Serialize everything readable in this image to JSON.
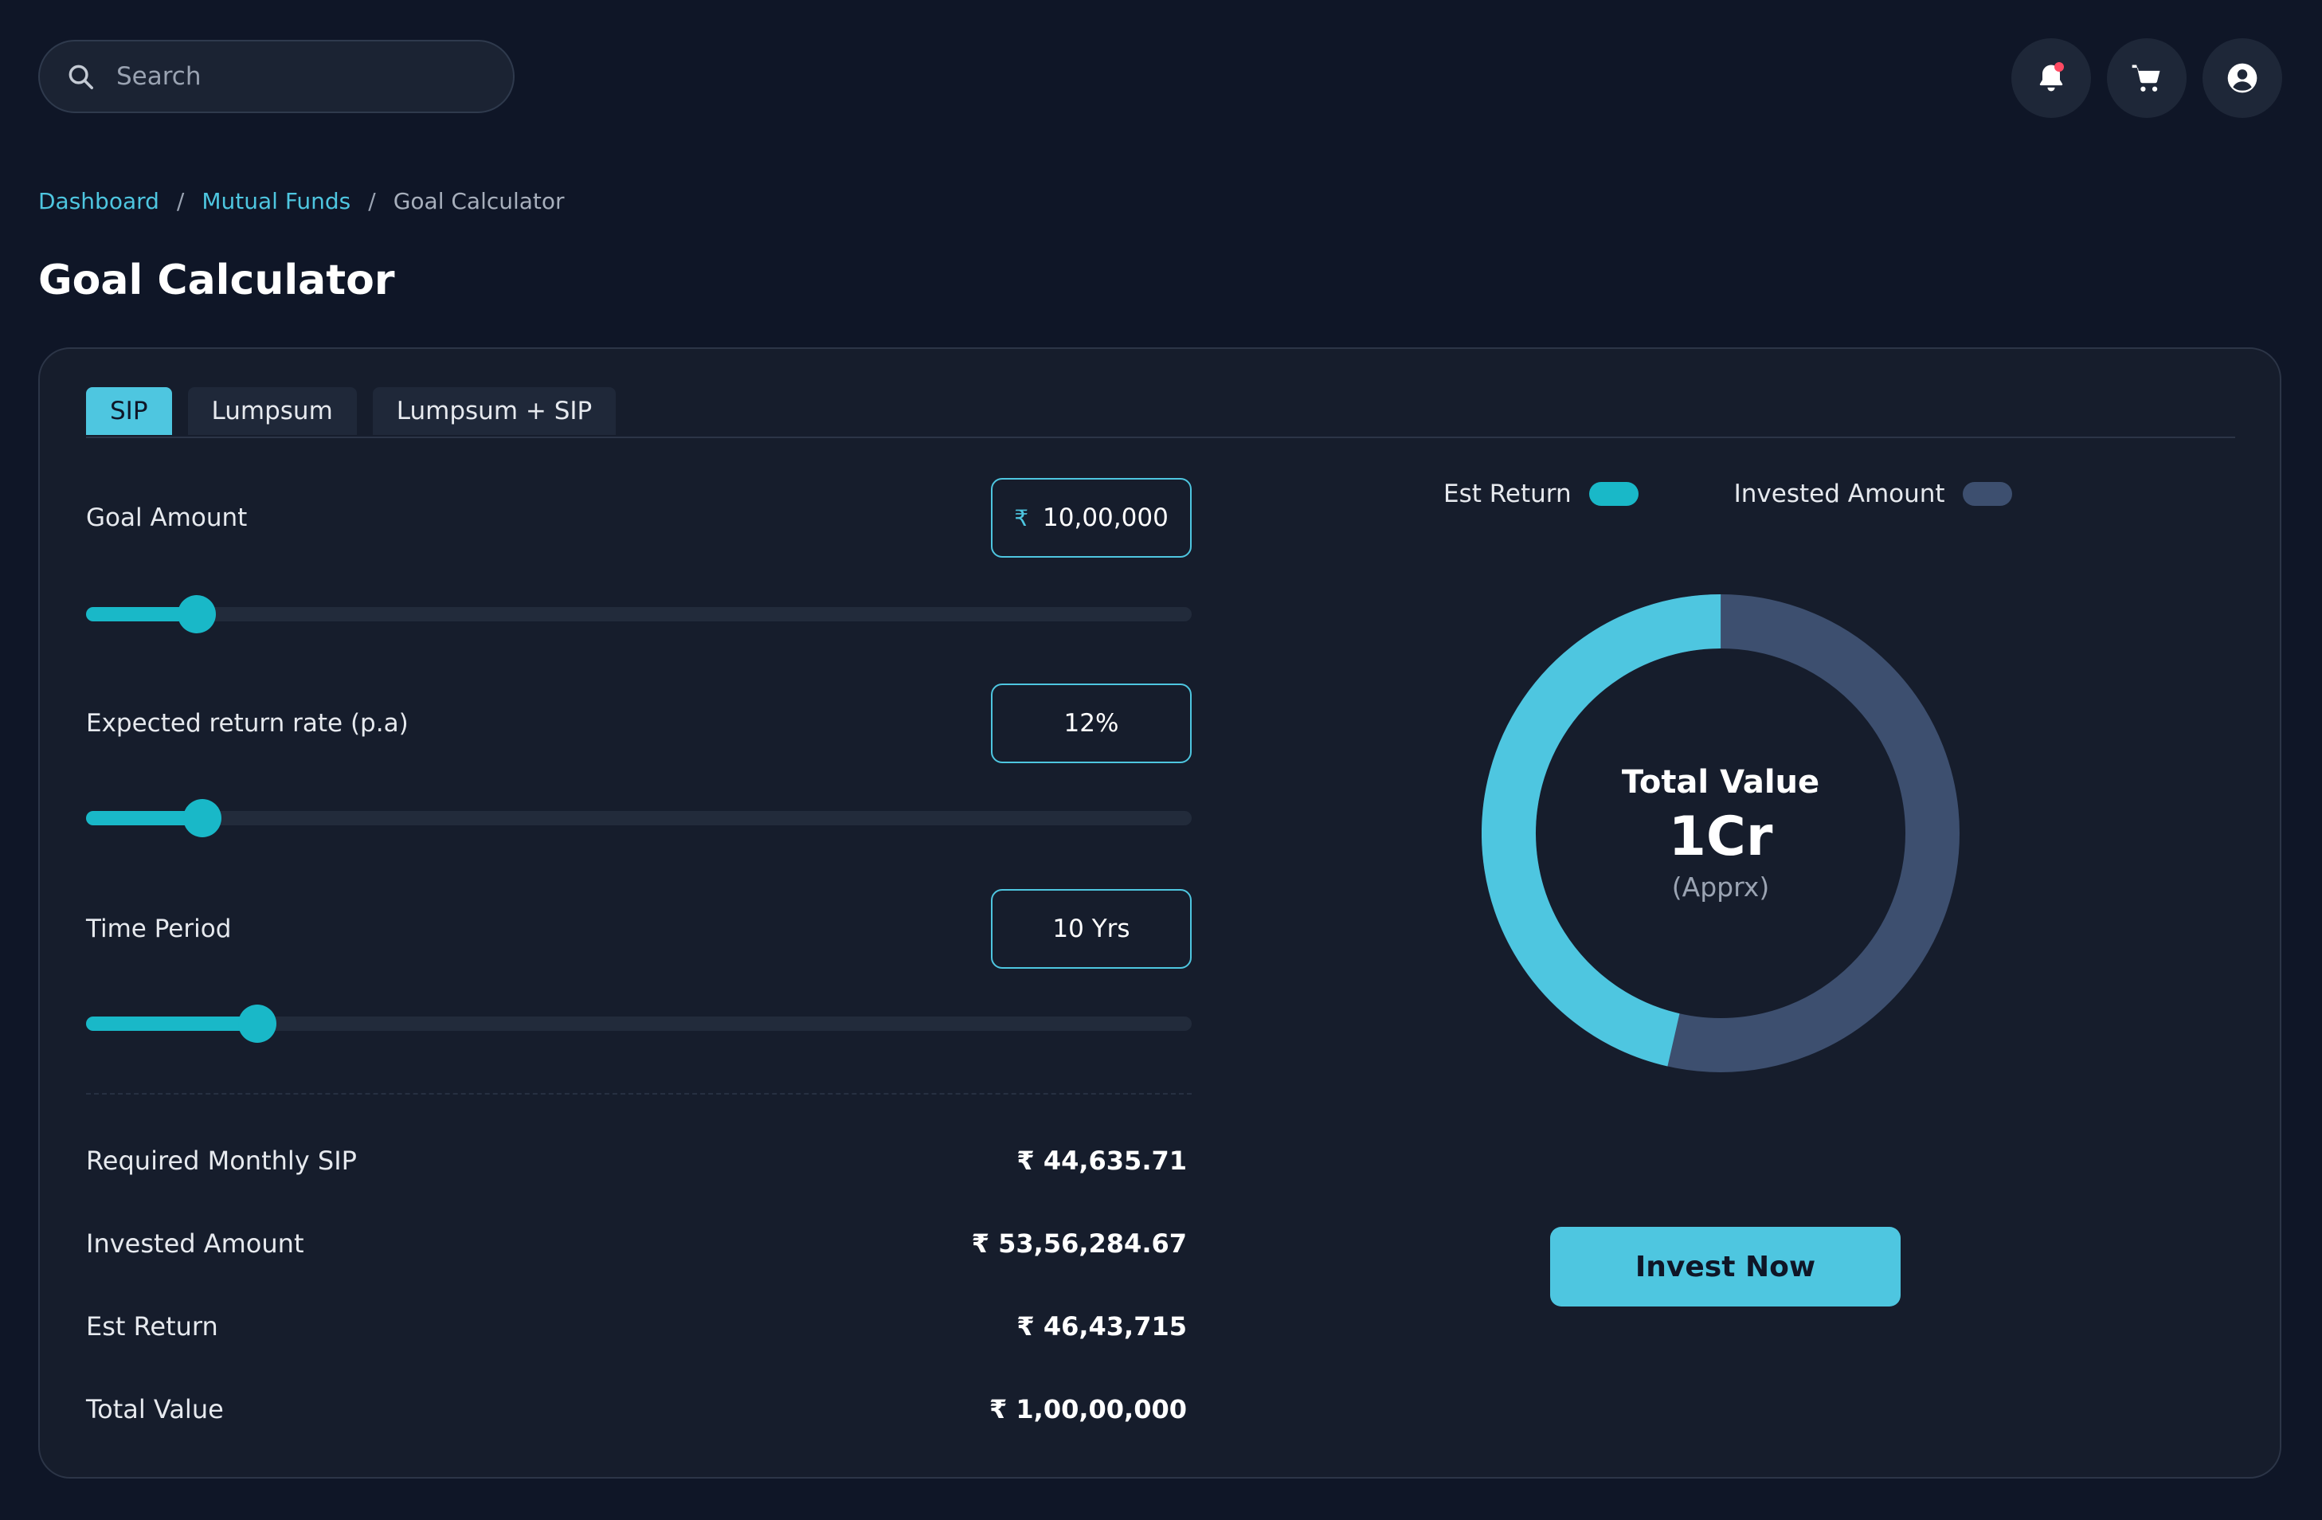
{
  "search": {
    "placeholder": "Search"
  },
  "breadcrumb": {
    "items": [
      "Dashboard",
      "Mutual Funds",
      "Goal Calculator"
    ],
    "separator": "/"
  },
  "page": {
    "title": "Goal Calculator"
  },
  "tabs": [
    {
      "label": "SIP",
      "active": true
    },
    {
      "label": "Lumpsum",
      "active": false
    },
    {
      "label": "Lumpsum + SIP",
      "active": false
    }
  ],
  "fields": {
    "goal_amount": {
      "label": "Goal Amount",
      "currency": "₹",
      "value": "10,00,000",
      "slider_percent": 10
    },
    "return_rate": {
      "label": "Expected return rate (p.a)",
      "value": "12%",
      "slider_percent": 10.5
    },
    "time_period": {
      "label": "Time Period",
      "value": "10 Yrs",
      "slider_percent": 15.5
    }
  },
  "results": [
    {
      "label": "Required Monthly SIP",
      "value": "₹ 44,635.71"
    },
    {
      "label": "Invested Amount",
      "value": "₹ 53,56,284.67"
    },
    {
      "label": "Est Return",
      "value": "₹ 46,43,715"
    },
    {
      "label": "Total Value",
      "value": "₹ 1,00,00,000"
    }
  ],
  "legend": {
    "est_return": "Est Return",
    "invested_amount": "Invested Amount"
  },
  "donut": {
    "title": "Total Value",
    "value": "1Cr",
    "sub": "(Apprx)",
    "est_return_value": 4643715,
    "invested_value": 5356284.67
  },
  "colors": {
    "accent": "#4ec6e0",
    "slider": "#19b8c8",
    "invested": "#3d4f6f",
    "background": "#0f1627",
    "card": "#161d2c"
  },
  "actions": {
    "invest_label": "Invest Now"
  }
}
